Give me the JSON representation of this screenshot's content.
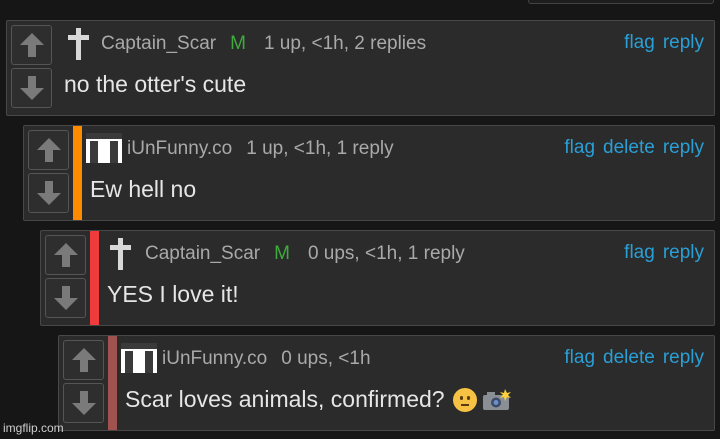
{
  "colors": {
    "link": "#2a9fd6",
    "mod_badge": "#3dab3d",
    "bar_level1": "#ff8a00",
    "bar_level2": "#ef3b3b",
    "bar_level3": "#a0524f"
  },
  "comments": [
    {
      "username": "Captain_Scar",
      "badge": "M",
      "stats": "1 up, <1h, 2 replies",
      "text": "no the otter's cute",
      "actions": [
        "flag",
        "reply"
      ],
      "avatar_icon": "cross-icon"
    },
    {
      "username": "iUnFunny.co",
      "badge": "",
      "stats": "1 up, <1h, 1 reply",
      "text": "Ew hell no",
      "actions": [
        "flag",
        "delete",
        "reply"
      ],
      "avatar_icon": "arch-avatar-icon"
    },
    {
      "username": "Captain_Scar",
      "badge": "M",
      "stats": "0 ups, <1h, 1 reply",
      "text": "YES I love it!",
      "actions": [
        "flag",
        "reply"
      ],
      "avatar_icon": "cross-icon"
    },
    {
      "username": "iUnFunny.co",
      "badge": "",
      "stats": "0 ups, <1h",
      "text": "Scar loves animals, confirmed?",
      "actions": [
        "flag",
        "delete",
        "reply"
      ],
      "avatar_icon": "arch-avatar-icon",
      "emojis": [
        "neutral-face-emoji",
        "camera-flash-emoji"
      ]
    }
  ],
  "watermark": "imgflip.com"
}
